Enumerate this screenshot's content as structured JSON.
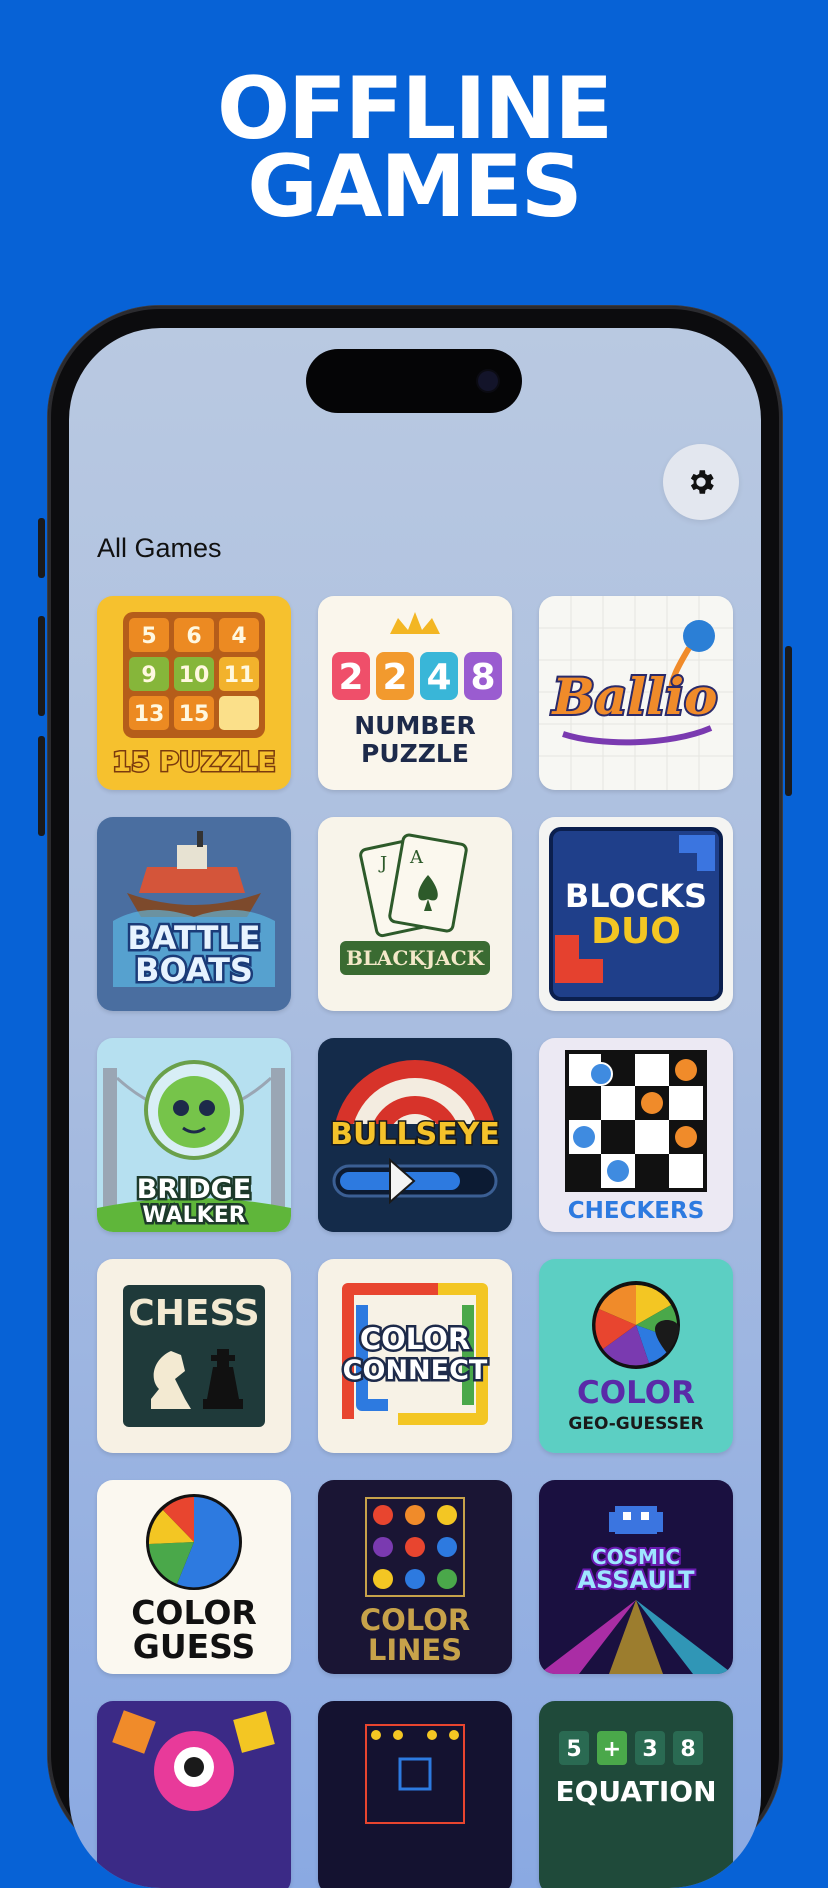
{
  "headline": {
    "line1": "OFFLINE",
    "line2": "GAMES"
  },
  "app": {
    "section_title": "All Games",
    "settings_icon": "gear-icon"
  },
  "games": [
    {
      "label": "15 PUZZLE",
      "numbers": [
        "5",
        "6",
        "4",
        "9",
        "10",
        "11",
        "13",
        "15"
      ]
    },
    {
      "label_digits": [
        "2",
        "2",
        "4",
        "8"
      ],
      "label_line1": "NUMBER",
      "label_line2": "PUZZLE"
    },
    {
      "label": "Ballio"
    },
    {
      "label_line1": "BATTLE",
      "label_line2": "BOATS"
    },
    {
      "label": "BLACKJACK",
      "card_rank": "A",
      "card_rank_back": "J"
    },
    {
      "label_line1": "BLOCKS",
      "label_line2": "DUO"
    },
    {
      "label_line1": "BRIDGE",
      "label_line2": "WALKER"
    },
    {
      "label": "BULLSEYE"
    },
    {
      "label": "CHECKERS"
    },
    {
      "label": "CHESS"
    },
    {
      "label_line1": "COLOR",
      "label_line2": "CONNECT"
    },
    {
      "label_line1": "COLOR",
      "label_line2": "GEO-GUESSER"
    },
    {
      "label_line1": "COLOR",
      "label_line2": "GUESS"
    },
    {
      "label_line1": "COLOR",
      "label_line2": "LINES"
    },
    {
      "label_line1": "COSMIC",
      "label_line2": "ASSAULT"
    },
    {
      "label": ""
    },
    {
      "label": ""
    },
    {
      "label": "EQUATION",
      "equation": [
        "5",
        "+",
        "3",
        "8"
      ]
    }
  ],
  "colors": {
    "background": "#0762d6",
    "headline": "#ffffff"
  }
}
